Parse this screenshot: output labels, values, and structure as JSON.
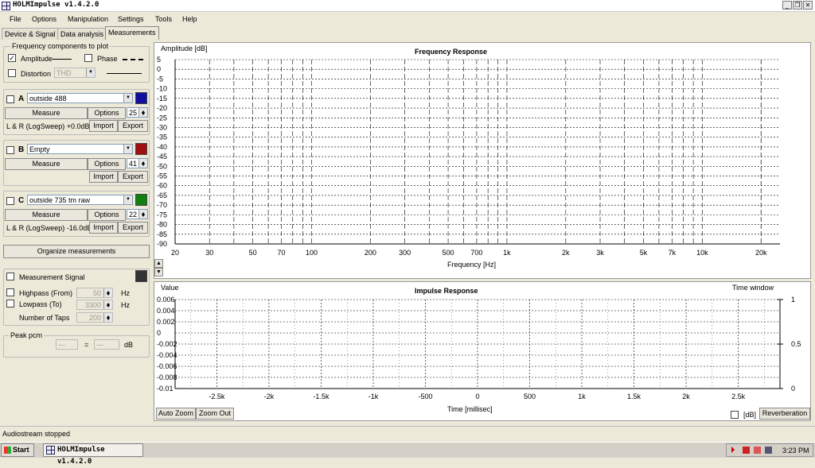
{
  "app": {
    "title": "HOLMImpulse  v1.4.2.0"
  },
  "window_buttons": {
    "minimize": "_",
    "restore": "❐",
    "close": "✕"
  },
  "menu": [
    "File",
    "Options",
    "Manipulation",
    "Settings",
    "Tools",
    "Help"
  ],
  "tabs": [
    "Device & Signal",
    "Data analysis",
    "Measurements"
  ],
  "freq_components": {
    "legend": "Frequency components to plot",
    "amplitude": {
      "label": "Amplitude",
      "checked": true
    },
    "phase": {
      "label": "Phase",
      "checked": false
    },
    "distortion": {
      "label": "Distortion",
      "checked": false,
      "select": "THD"
    }
  },
  "measurements": [
    {
      "letter": "A",
      "name": "outside 488",
      "color": "#1010a0",
      "measure_label": "Measure",
      "options_label": "Options",
      "spin": "25",
      "info": "L & R (LogSweep) +0.0dB",
      "import_label": "Import",
      "export_label": "Export"
    },
    {
      "letter": "B",
      "name": "Empty",
      "color": "#a01010",
      "measure_label": "Measure",
      "options_label": "Options",
      "spin": "41",
      "info": "",
      "import_label": "Import",
      "export_label": "Export"
    },
    {
      "letter": "C",
      "name": "outside 735 tm raw",
      "color": "#108010",
      "measure_label": "Measure",
      "options_label": "Options",
      "spin": "22",
      "info": "L & R (LogSweep) -16.0dB",
      "import_label": "Import",
      "export_label": "Export"
    }
  ],
  "organize_label": "Organize measurements",
  "measurement_signal": {
    "label": "Measurement Signal",
    "highpass_label": "Highpass (From)",
    "highpass_value": "50",
    "lowpass_label": "Lowpass (To)",
    "lowpass_value": "3300",
    "taps_label": "Number of Taps",
    "taps_value": "200",
    "hz": "Hz"
  },
  "peak": {
    "legend": "Peak pcm",
    "left": "---",
    "eq": "=",
    "right": "---",
    "unit": "dB"
  },
  "freq_chart": {
    "title": "Frequency Response",
    "ylabel": "Amplitude [dB]",
    "xlabel": "Frequency [Hz]",
    "yticks": [
      "5",
      "0",
      "-5",
      "-10",
      "-15",
      "-20",
      "-25",
      "-30",
      "-35",
      "-40",
      "-45",
      "-50",
      "-55",
      "-60",
      "-65",
      "-70",
      "-75",
      "-80",
      "-85",
      "-90"
    ],
    "xticks": [
      "20",
      "30",
      "50",
      "70",
      "100",
      "200",
      "300",
      "500",
      "700",
      "1k",
      "2k",
      "3k",
      "5k",
      "7k",
      "10k",
      "20k"
    ]
  },
  "impulse_chart": {
    "title": "Impulse Response",
    "ylabel": "Value",
    "rlabel": "Time window",
    "xlabel": "Time [millisec]",
    "yticks": [
      "0.006",
      "0.004",
      "0.002",
      "0",
      "-0.002",
      "-0.004",
      "-0.006",
      "-0.008",
      "-0.01"
    ],
    "xticks": [
      "-2.5k",
      "-2k",
      "-1.5k",
      "-1k",
      "-500",
      "0",
      "500",
      "1k",
      "1.5k",
      "2k",
      "2.5k"
    ],
    "rticks": [
      "1",
      "0.5",
      "0"
    ],
    "auto_zoom": "Auto Zoom",
    "zoom_out": "Zoom Out",
    "db_label": "[dB]",
    "reverb_label": "Reverberation"
  },
  "chart_data": [
    {
      "type": "line",
      "title": "Frequency Response",
      "xlabel": "Frequency [Hz]",
      "ylabel": "Amplitude [dB]",
      "xscale": "log",
      "xlim": [
        20,
        25000
      ],
      "ylim": [
        -90,
        5
      ],
      "grid": true,
      "series": []
    },
    {
      "type": "line",
      "title": "Impulse Response",
      "xlabel": "Time [millisec]",
      "ylabel": "Value",
      "xlim": [
        -2900,
        2900
      ],
      "ylim": [
        -0.01,
        0.006
      ],
      "grid": true,
      "series": []
    }
  ],
  "status": "Audiostream stopped",
  "taskbar": {
    "start": "Start",
    "item": "HOLMImpulse  v1.4.2.0",
    "time": "3:23 PM"
  }
}
